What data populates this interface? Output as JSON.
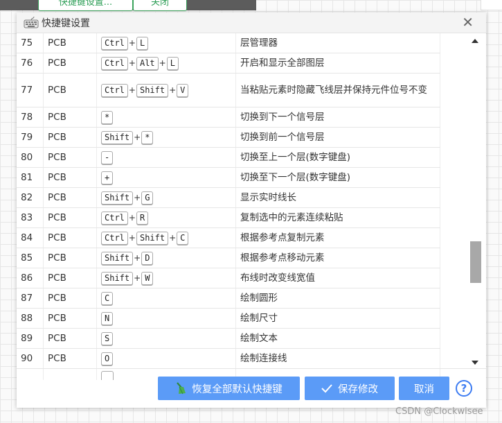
{
  "topbar": {
    "tab1": "快捷键设置...",
    "tab2": "关闭"
  },
  "dialog": {
    "title": "快捷键设置",
    "close_symbol": "✕"
  },
  "rows": [
    {
      "id": "75",
      "cat": "PCB",
      "keys": [
        "Ctrl",
        "L"
      ],
      "desc": "层管理器"
    },
    {
      "id": "76",
      "cat": "PCB",
      "keys": [
        "Ctrl",
        "Alt",
        "L"
      ],
      "desc": "开启和显示全部图层"
    },
    {
      "id": "77",
      "cat": "PCB",
      "keys": [
        "Ctrl",
        "Shift",
        "V"
      ],
      "desc": "当粘贴元素时隐藏飞线层并保持元件位号不变"
    },
    {
      "id": "78",
      "cat": "PCB",
      "keys": [
        "*"
      ],
      "desc": "切换到下一个信号层"
    },
    {
      "id": "79",
      "cat": "PCB",
      "keys": [
        "Shift",
        "*"
      ],
      "desc": "切换到前一个信号层"
    },
    {
      "id": "80",
      "cat": "PCB",
      "keys": [
        "-"
      ],
      "desc": "切换至上一个层(数字键盘)"
    },
    {
      "id": "81",
      "cat": "PCB",
      "keys": [
        "+"
      ],
      "desc": "切换至下一个层(数字键盘)"
    },
    {
      "id": "82",
      "cat": "PCB",
      "keys": [
        "Shift",
        "G"
      ],
      "desc": "显示实时线长"
    },
    {
      "id": "83",
      "cat": "PCB",
      "keys": [
        "Ctrl",
        "R"
      ],
      "desc": "复制选中的元素连续粘贴"
    },
    {
      "id": "84",
      "cat": "PCB",
      "keys": [
        "Ctrl",
        "Shift",
        "C"
      ],
      "desc": "根据参考点复制元素"
    },
    {
      "id": "85",
      "cat": "PCB",
      "keys": [
        "Shift",
        "D"
      ],
      "desc": "根据参考点移动元素"
    },
    {
      "id": "86",
      "cat": "PCB",
      "keys": [
        "Shift",
        "W"
      ],
      "desc": "布线时改变线宽值"
    },
    {
      "id": "87",
      "cat": "PCB",
      "keys": [
        "C"
      ],
      "desc": "绘制圆形"
    },
    {
      "id": "88",
      "cat": "PCB",
      "keys": [
        "N"
      ],
      "desc": "绘制尺寸"
    },
    {
      "id": "89",
      "cat": "PCB",
      "keys": [
        "S"
      ],
      "desc": "绘制文本"
    },
    {
      "id": "90",
      "cat": "PCB",
      "keys": [
        "O"
      ],
      "desc": "绘制连接线"
    },
    {
      "id": "",
      "cat": "",
      "keys": [
        ""
      ],
      "desc": ""
    }
  ],
  "buttons": {
    "restore": "恢复全部默认快捷键",
    "save": "保存修改",
    "cancel": "取消",
    "help": "?"
  },
  "colors": {
    "primary": "#5b9bf7",
    "help": "#3d7cf2",
    "topbar_accent": "#2e9e57"
  },
  "watermark": "CSDN @Clockwisee"
}
